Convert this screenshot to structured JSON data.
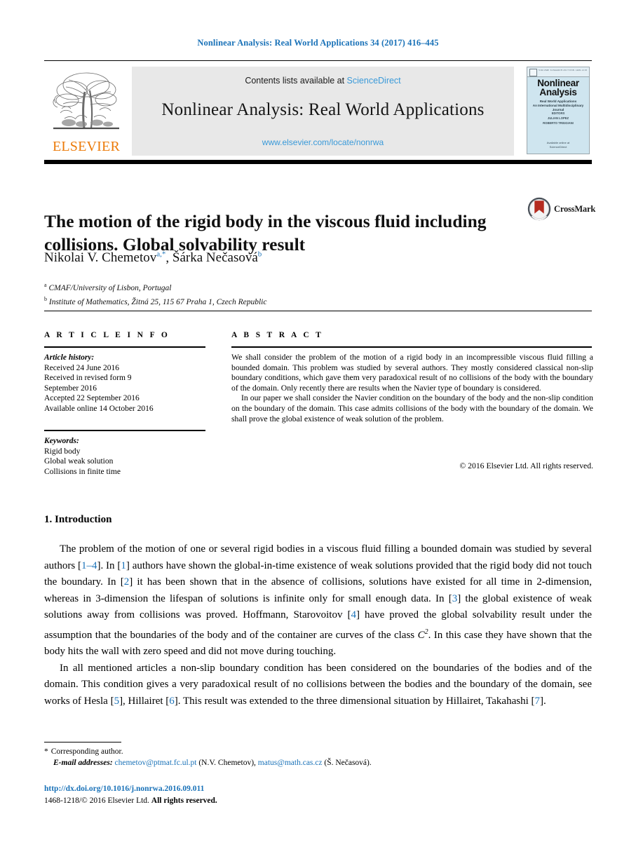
{
  "running_head": "Nonlinear Analysis: Real World Applications 34 (2017) 416–445",
  "masthead": {
    "publisher_name": "ELSEVIER",
    "contents_prefix": "Contents lists available at ",
    "sciencedirect": "ScienceDirect",
    "journal_title": "Nonlinear Analysis: Real World Applications",
    "journal_url": "www.elsevier.com/locate/nonrwa",
    "cover": {
      "title_line1": "Nonlinear",
      "title_line2": "Analysis",
      "subtitle_line1": "Real World Applications",
      "subtitle_line2": "An International Multidisciplinary Journal",
      "mid_line1": "EDITORS",
      "mid_line2": "JULIAN LOPEZ",
      "mid_line3": "ROBERTO TRIGGIANI",
      "foot_line1": "Available online at",
      "foot_line2": "ScienceDirect",
      "top_left": "VOLUME 34",
      "top_mid": "MARCH 2017",
      "top_right": "ISSN 1468-1218"
    }
  },
  "article": {
    "title": "The motion of the rigid body in the viscous fluid including collisions. Global solvability result",
    "crossmark_label": "CrossMark",
    "authors": [
      {
        "name": "Nikolai V. Chemetov",
        "marks": "a,*"
      },
      {
        "name": "Šárka Nečasová",
        "marks": "b"
      }
    ],
    "affiliations": [
      {
        "mark": "a",
        "text": "CMAF/University of Lisbon, Portugal"
      },
      {
        "mark": "b",
        "text": "Institute of Mathematics, Žitná 25, 115 67 Praha 1, Czech Republic"
      }
    ]
  },
  "article_info": {
    "heading": "A R T I C L E   I N F O",
    "history_label": "Article history:",
    "history": [
      "Received 24 June 2016",
      "Received in revised form 9",
      "September 2016",
      "Accepted 22 September 2016",
      "Available online 14 October 2016"
    ],
    "keywords_label": "Keywords:",
    "keywords": [
      "Rigid body",
      "Global weak solution",
      "Collisions in finite time"
    ]
  },
  "abstract": {
    "heading": "A B S T R A C T",
    "paragraph1": "We shall consider the problem of the motion of a rigid body in an incompressible viscous fluid filling a bounded domain. This problem was studied by several authors. They mostly considered classical non-slip boundary conditions, which gave them very paradoxical result of no collisions of the body with the boundary of the domain. Only recently there are results when the Navier type of boundary is considered.",
    "paragraph2": "In our paper we shall consider the Navier condition on the boundary of the body and the non-slip condition on the boundary of the domain. This case admits collisions of the body with the boundary of the domain. We shall prove the global existence of weak solution of the problem.",
    "copyright": "© 2016 Elsevier Ltd. All rights reserved."
  },
  "section": {
    "heading": "1. Introduction"
  },
  "footnotes": {
    "corresponding": "Corresponding author.",
    "email_label": "E-mail addresses:",
    "email1": "chemetov@ptmat.fc.ul.pt",
    "email1_author": "(N.V. Chemetov),",
    "email2": "matus@math.cas.cz",
    "email2_author": "(Š. Nečasová)."
  },
  "footer": {
    "doi": "http://dx.doi.org/10.1016/j.nonrwa.2016.09.011",
    "issn_copyright_plain": "1468-1218/© 2016 Elsevier Ltd. ",
    "issn_copyright_bold": "All rights reserved."
  },
  "colors": {
    "link_blue": "#1a72b8",
    "sciencedirect_blue": "#3a9ad9",
    "elsevier_orange": "#ec7a08",
    "banner_gray": "#e8e8e8",
    "cover_blue": "#cfe5ef"
  }
}
